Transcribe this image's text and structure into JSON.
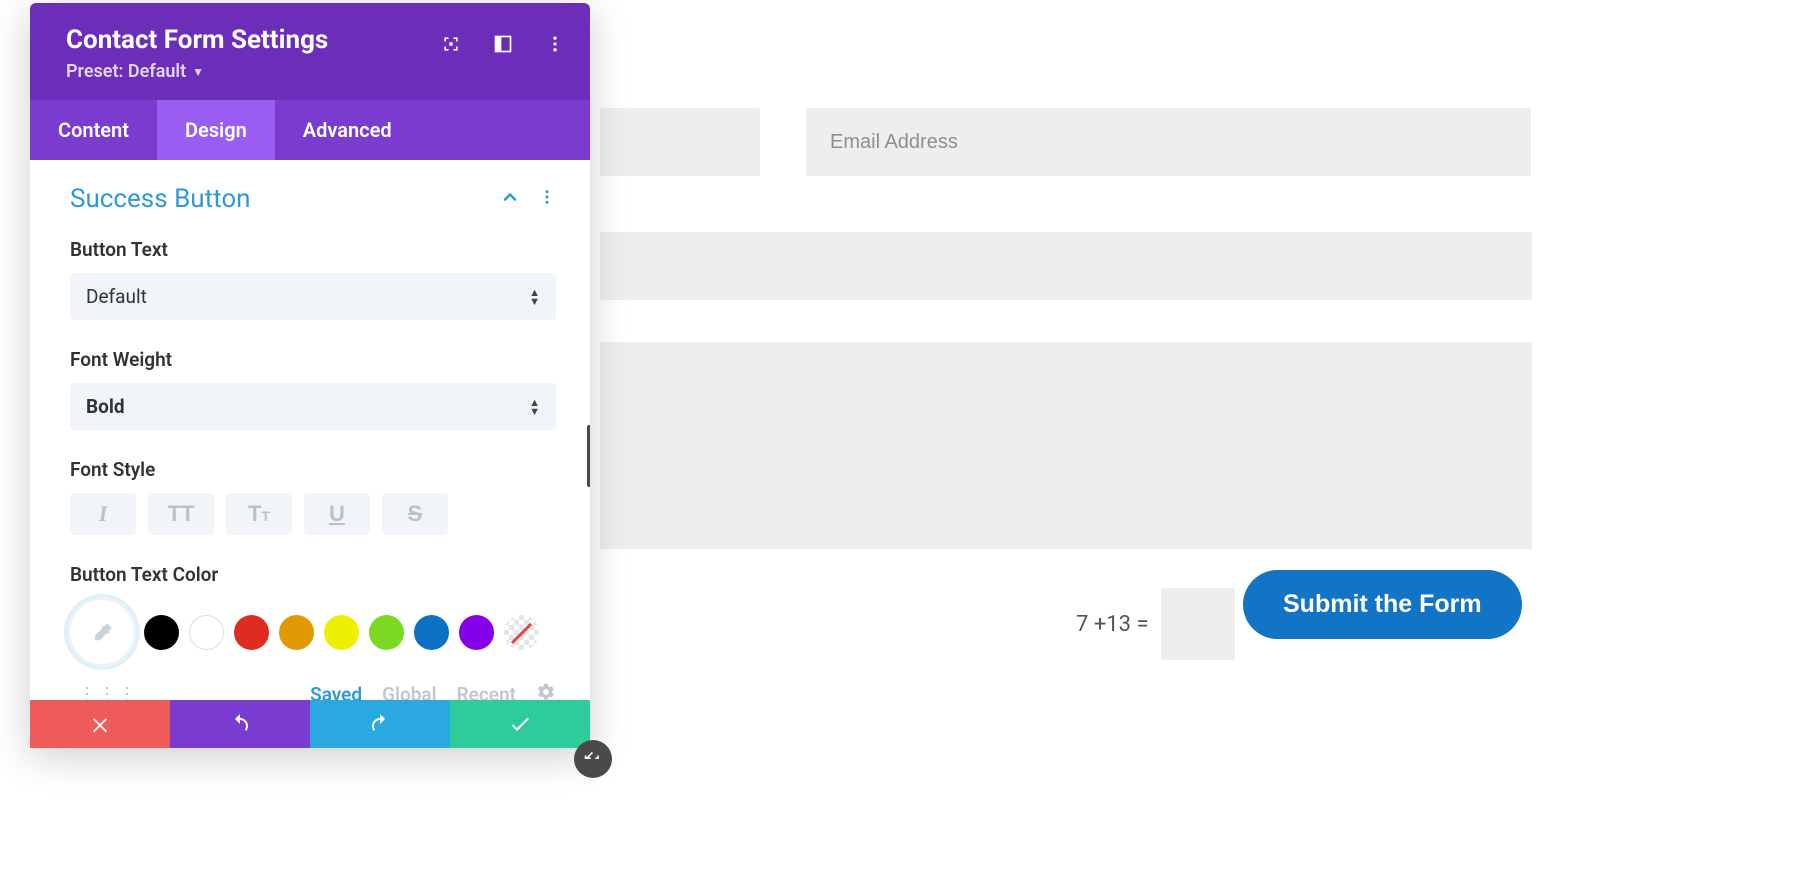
{
  "panel": {
    "title": "Contact Form Settings",
    "preset_label": "Preset: Default"
  },
  "tabs": {
    "content": "Content",
    "design": "Design",
    "advanced": "Advanced"
  },
  "section": {
    "title": "Success Button"
  },
  "fields": {
    "button_text": {
      "label": "Button Text",
      "value": "Default"
    },
    "font_weight": {
      "label": "Font Weight",
      "value": "Bold"
    },
    "font_style": {
      "label": "Font Style"
    },
    "button_text_color": {
      "label": "Button Text Color"
    }
  },
  "color_tabs": {
    "saved": "Saved",
    "global": "Global",
    "recent": "Recent"
  },
  "swatches": {
    "black": "#000000",
    "white": "#ffffff",
    "red": "#e02b20",
    "orange": "#e09900",
    "yellow": "#edf000",
    "green": "#7cda24",
    "blue": "#0c71c3",
    "purple": "#8300e9"
  },
  "form": {
    "email_placeholder": "Email Address",
    "captcha_expr": "7 +13 =",
    "submit_label": "Submit the Form"
  }
}
